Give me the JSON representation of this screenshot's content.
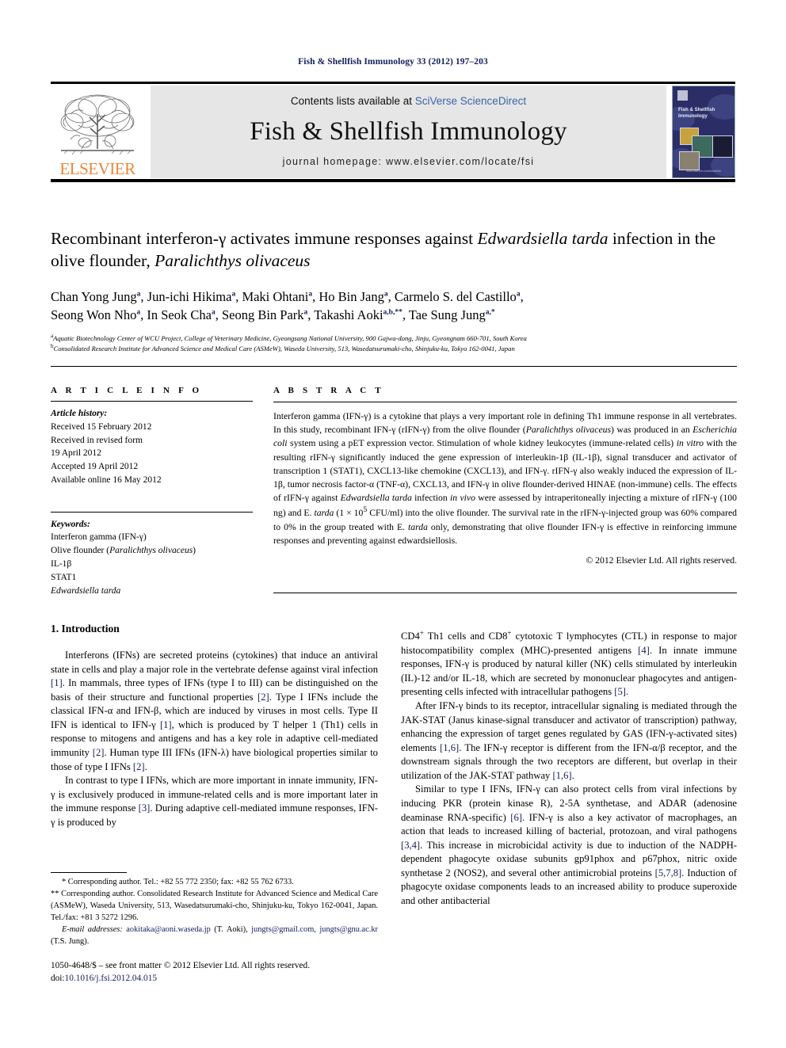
{
  "running_head": "Fish & Shellfish Immunology 33 (2012) 197–203",
  "masthead": {
    "publisher_logo_label": "ELSEVIER",
    "contents_prefix": "Contents lists available at ",
    "contents_link": "SciVerse ScienceDirect",
    "journal_name": "Fish & Shellfish Immunology",
    "homepage": "journal homepage: www.elsevier.com/locate/fsi",
    "cover": {
      "title_line1": "Fish & Shellfish",
      "title_line2": "Immunology",
      "footer": "www.elsevier.com/locate/fsi"
    }
  },
  "article": {
    "title_part1": "Recombinant interferon-γ activates immune responses against ",
    "title_italic1": "Edwardsiella tarda",
    "title_part2": " infection in the olive flounder, ",
    "title_italic2": "Paralichthys olivaceus",
    "authors_line1": "Chan Yong Jung , Jun-ichi Hikima , Maki Ohtani , Ho Bin Jang , Carmelo S. del Castillo ,",
    "authors_line2": "Seong Won Nho , In Seok Cha , Seong Bin Park , Takashi Aoki , Tae Sung Jung",
    "authors": [
      {
        "name": "Chan Yong Jung",
        "sup": "a"
      },
      {
        "name": "Jun-ichi Hikima",
        "sup": "a"
      },
      {
        "name": "Maki Ohtani",
        "sup": "a"
      },
      {
        "name": "Ho Bin Jang",
        "sup": "a"
      },
      {
        "name": "Carmelo S. del Castillo",
        "sup": "a"
      },
      {
        "name": "Seong Won Nho",
        "sup": "a"
      },
      {
        "name": "In Seok Cha",
        "sup": "a"
      },
      {
        "name": "Seong Bin Park",
        "sup": "a"
      },
      {
        "name": "Takashi Aoki",
        "sup": "a,b,**"
      },
      {
        "name": "Tae Sung Jung",
        "sup": "a,*"
      }
    ],
    "affiliation_a": "Aquatic Biotechnology Center of WCU Project, College of Veterinary Medicine, Gyeongsang National University, 900 Gajwa-dong, Jinju, Gyeongnam 660-701, South Korea",
    "affiliation_b": "Consolidated Research Institute for Advanced Science and Medical Care (ASMeW), Waseda University, 513, Wasedatsurumaki-cho, Shinjuku-ku, Tokyo 162-0041, Japan",
    "affiliation_a_sup": "a",
    "affiliation_b_sup": "b"
  },
  "article_info": {
    "heading": "A R T I C L E  I N F O",
    "history_label": "Article history:",
    "history": [
      "Received 15 February 2012",
      "Received in revised form",
      "19 April 2012",
      "Accepted 19 April 2012",
      "Available online 16 May 2012"
    ],
    "keywords_label": "Keywords:",
    "keywords": [
      "Interferon gamma (IFN-γ)",
      "Olive flounder (Paralichthys olivaceus)",
      "IL-1β",
      "STAT1",
      "Edwardsiella tarda"
    ]
  },
  "abstract": {
    "heading": "A B S T R A C T",
    "copyright": "© 2012 Elsevier Ltd. All rights reserved.",
    "paragraph_plain": "Interferon gamma (IFN-γ) is a cytokine that plays a very important role in defining Th1 immune response in all vertebrates. In this study, recombinant IFN-γ (rIFN-γ) from the olive flounder (Paralichthys olivaceus) was produced in an Escherichia coli system using a pET expression vector. Stimulation of whole kidney leukocytes (immune-related cells) in vitro with the resulting rIFN-γ significantly induced the gene expression of interleukin-1β (IL-1β), signal transducer and activator of transcription 1 (STAT1), CXCL13-like chemokine (CXCL13), and IFN-γ. rIFN-γ also weakly induced the expression of IL-1β, tumor necrosis factor-α (TNF-α), CXCL13, and IFN-γ in olive flounder-derived HINAE (non-immune) cells. The effects of rIFN-γ against Edwardsiella tarda infection in vivo were assessed by intraperitoneally injecting a mixture of rIFN-γ (100 ng) and E. tarda (1 × 10⁵ CFU/ml) into the olive flounder. The survival rate in the rIFN-γ-injected group was 60% compared to 0% in the group treated with E. tarda only, demonstrating that olive flounder IFN-γ is effective in reinforcing immune responses and preventing against edwardsiellosis."
  },
  "introduction": {
    "heading": "1.  Introduction",
    "left_paragraphs": [
      "Interferons (IFNs) are secreted proteins (cytokines) that induce an antiviral state in cells and play a major role in the vertebrate defense against viral infection [1]. In mammals, three types of IFNs (type I to III) can be distinguished on the basis of their structure and functional properties [2]. Type I IFNs include the classical IFN-α and IFN-β, which are induced by viruses in most cells. Type II IFN is identical to IFN-γ [1], which is produced by T helper 1 (Th1) cells in response to mitogens and antigens and has a key role in adaptive cell-mediated immunity [2]. Human type III IFNs (IFN-λ) have biological properties similar to those of type I IFNs [2].",
      "In contrast to type I IFNs, which are more important in innate immunity, IFN-γ is exclusively produced in immune-related cells and is more important later in the immune response [3]. During adaptive cell-mediated immune responses, IFN-γ is produced by"
    ],
    "right_paragraphs": [
      "CD4⁺ Th1 cells and CD8⁺ cytotoxic T lymphocytes (CTL) in response to major histocompatibility complex (MHC)-presented antigens [4]. In innate immune responses, IFN-γ is produced by natural killer (NK) cells stimulated by interleukin (IL)-12 and/or IL-18, which are secreted by mononuclear phagocytes and antigen-presenting cells infected with intracellular pathogens [5].",
      "After IFN-γ binds to its receptor, intracellular signaling is mediated through the JAK-STAT (Janus kinase-signal transducer and activator of transcription) pathway, enhancing the expression of target genes regulated by GAS (IFN-γ-activated sites) elements [1,6]. The IFN-γ receptor is different from the IFN-α/β receptor, and the downstream signals through the two receptors are different, but overlap in their utilization of the JAK-STAT pathway [1,6].",
      "Similar to type I IFNs, IFN-γ can also protect cells from viral infections by inducing PKR (protein kinase R), 2-5A synthetase, and ADAR (adenosine deaminase RNA-specific) [6]. IFN-γ is also a key activator of macrophages, an action that leads to increased killing of bacterial, protozoan, and viral pathogens [3,4]. This increase in microbicidal activity is due to induction of the NADPH-dependent phagocyte oxidase subunits gp91phox and p67phox, nitric oxide synthetase 2 (NOS2), and several other antimicrobial proteins [5,7,8]. Induction of phagocyte oxidase components leads to an increased ability to produce superoxide and other antibacterial"
    ]
  },
  "footnotes": {
    "corr1": "* Corresponding author. Tel.: +82 55 772 2350; fax: +82 55 762 6733.",
    "corr2": "** Corresponding author. Consolidated Research Institute for Advanced Science and Medical Care (ASMeW), Waseda University, 513, Wasedatsurumaki-cho, Shinjuku-ku, Tokyo 162-0041, Japan. Tel./fax: +81 3 5272 1296.",
    "email_label": "E-mail addresses:",
    "email1": "aokitaka@aoni.waseda.jp",
    "email1_owner": "(T. Aoki),",
    "email2": "jungts@gmail.com,",
    "email3": "jungts@gnu.ac.kr",
    "email3_owner": "(T.S. Jung)."
  },
  "imprint": {
    "issn_line": "1050-4648/$ – see front matter © 2012 Elsevier Ltd. All rights reserved.",
    "doi_label": "doi:",
    "doi_value": "10.1016/j.fsi.2012.04.015"
  }
}
